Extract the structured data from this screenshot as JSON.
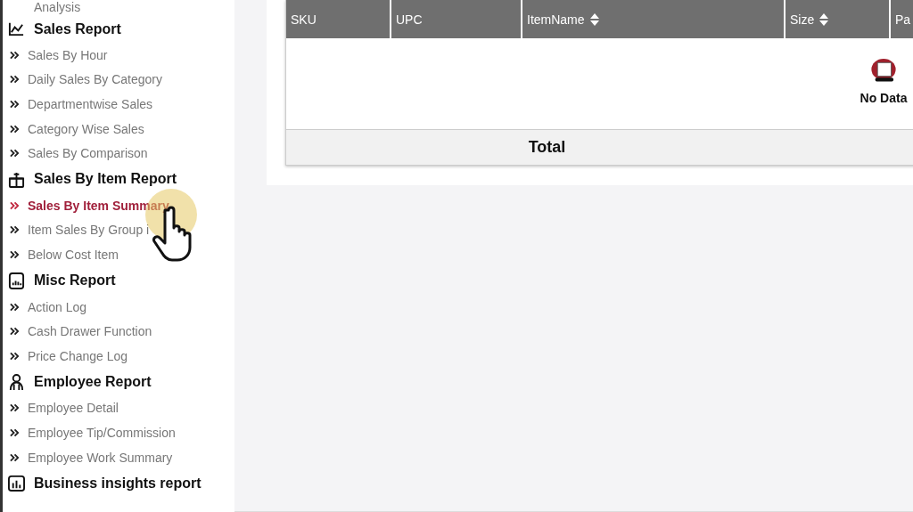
{
  "sidebar": {
    "top_item": {
      "label": "Analysis"
    },
    "sections": [
      {
        "kind": "chart",
        "title": "Sales Report",
        "items": [
          {
            "label": "Sales By Hour",
            "selected": false
          },
          {
            "label": "Daily Sales By Category",
            "selected": false
          },
          {
            "label": "Departmentwise Sales",
            "selected": false
          },
          {
            "label": "Category Wise Sales",
            "selected": false
          },
          {
            "label": "Sales By Comparison",
            "selected": false
          }
        ]
      },
      {
        "kind": "gift",
        "title": "Sales By Item Report",
        "items": [
          {
            "label": "Sales By Item Summary",
            "selected": true
          },
          {
            "label": "Item Sales By Group i",
            "selected": false
          },
          {
            "label": "Below Cost Item",
            "selected": false
          }
        ]
      },
      {
        "kind": "document",
        "title": "Misc Report",
        "items": [
          {
            "label": "Action Log",
            "selected": false
          },
          {
            "label": "Cash Drawer Function",
            "selected": false
          },
          {
            "label": "Price Change Log",
            "selected": false
          }
        ]
      },
      {
        "kind": "person",
        "title": "Employee Report",
        "items": [
          {
            "label": "Employee Detail",
            "selected": false
          },
          {
            "label": "Employee Tip/Commission",
            "selected": false
          },
          {
            "label": "Employee Work Summary",
            "selected": false
          }
        ]
      },
      {
        "kind": "bars",
        "title": "Business insights report"
      }
    ]
  },
  "table": {
    "columns": [
      {
        "label": "SKU",
        "sortable": false
      },
      {
        "label": "UPC",
        "sortable": false
      },
      {
        "label": "ItemName",
        "sortable": true
      },
      {
        "label": "Size",
        "sortable": true
      },
      {
        "label": "Pa"
      }
    ],
    "empty_message": "No Data",
    "total_label": "Total"
  }
}
